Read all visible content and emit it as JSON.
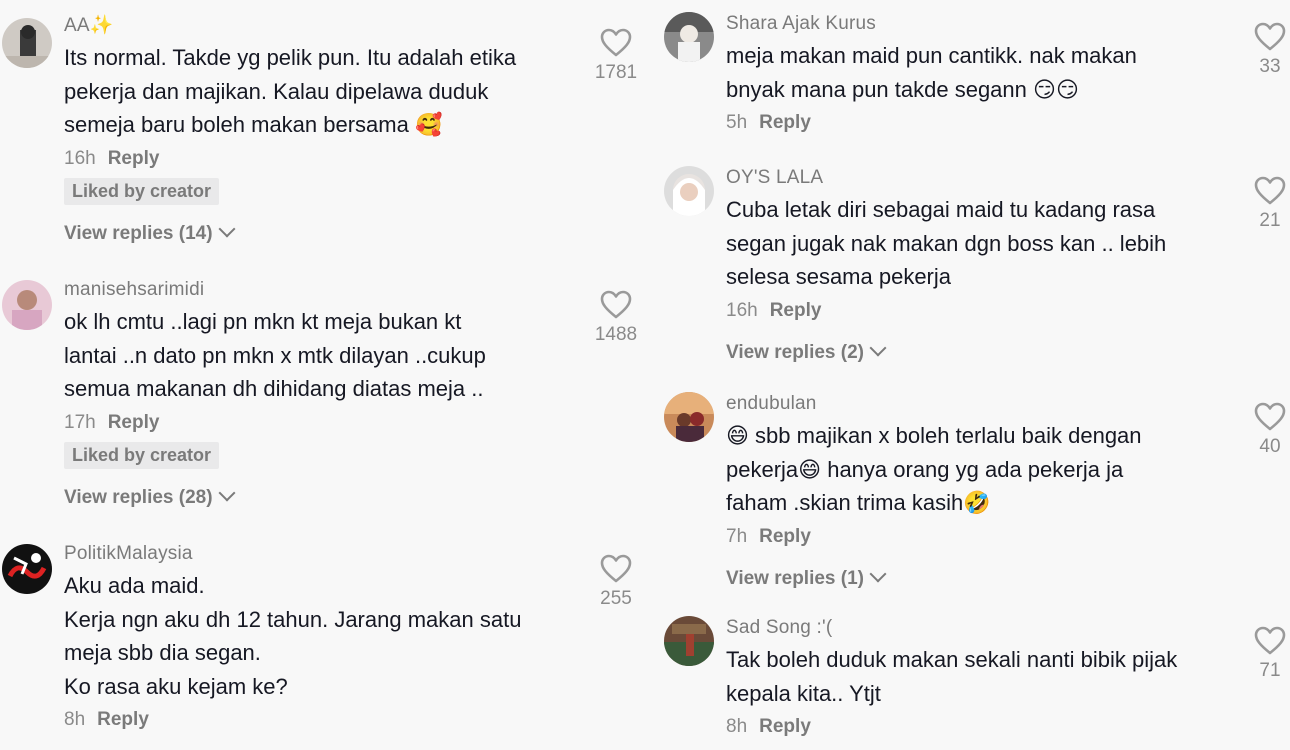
{
  "left_column": [
    {
      "username": "AA",
      "username_suffix": "✨",
      "text": "Its normal. Takde yg pelik pun. Itu adalah etika\npekerja dan majikan. Kalau dipelawa duduk\nsemeja baru boleh makan bersama",
      "emoji": "🥰",
      "time": "16h",
      "reply": "Reply",
      "badge": "Liked by creator",
      "view_replies": "View replies (14)",
      "likes": "1781"
    },
    {
      "username": "manisehsarimidi",
      "text": "ok lh cmtu ..lagi pn mkn kt meja bukan kt\nlantai ..n dato pn mkn x mtk dilayan ..cukup\nsemua makanan dh dihidang diatas meja ..",
      "time": "17h",
      "reply": "Reply",
      "badge": "Liked by creator",
      "view_replies": "View replies (28)",
      "likes": "1488"
    },
    {
      "username": "PolitikMalaysia",
      "text": "Aku ada maid.\nKerja ngn aku dh 12 tahun. Jarang makan satu\nmeja sbb dia segan.\nKo rasa aku kejam ke?",
      "time": "8h",
      "reply": "Reply",
      "likes": "255"
    }
  ],
  "right_column": [
    {
      "username": "Shara Ajak Kurus",
      "text": "meja makan maid pun cantikk. nak makan\nbnyak mana pun takde segann",
      "emoji": "😏😏",
      "time": "5h",
      "reply": "Reply",
      "likes": "33"
    },
    {
      "username": "OY'S LALA",
      "text": "Cuba letak diri sebagai maid tu kadang rasa\nsegan jugak nak makan dgn boss kan .. lebih\nselesa sesama pekerja",
      "time": "16h",
      "reply": "Reply",
      "view_replies": "View replies (2)",
      "likes": "21"
    },
    {
      "username": "endubulan",
      "text_prefix_emoji": "😄",
      "text": " sbb majikan x boleh terlalu baik dengan\npekerja😄 hanya orang yg ada pekerja ja\nfaham .skian trima kasih🤣",
      "time": "7h",
      "reply": "Reply",
      "view_replies": "View replies (1)",
      "likes": "40"
    },
    {
      "username": "Sad Song :'(",
      "text": "Tak boleh duduk makan sekali nanti bibik pijak\nkepala kita.. Ytjt",
      "time": "8h",
      "reply": "Reply",
      "likes": "71"
    }
  ],
  "icons": {
    "like": "heart-outline-icon",
    "chevron": "chevron-down-icon"
  },
  "colors": {
    "background": "#f8f8f8",
    "text": "#161823",
    "muted": "#8a8a8a",
    "badge_bg": "#e9e9ea"
  }
}
